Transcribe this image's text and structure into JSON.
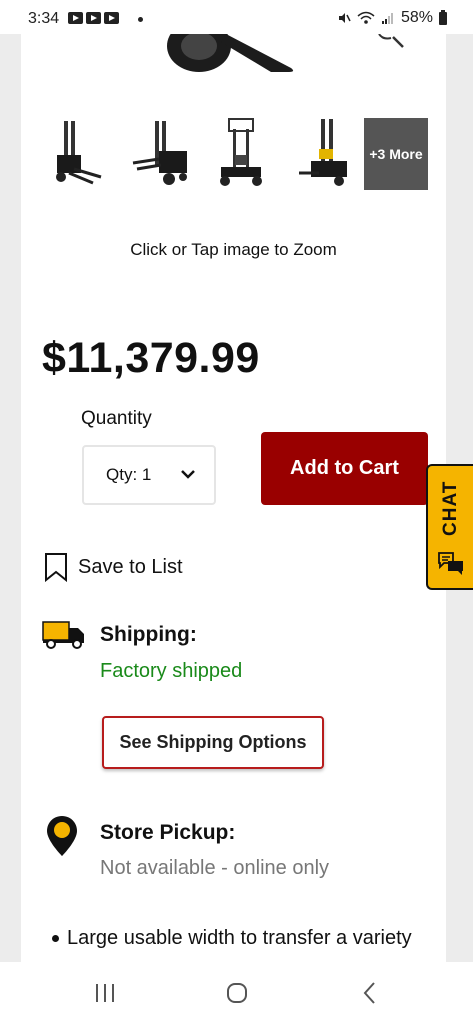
{
  "status_bar": {
    "time": "3:34",
    "battery": "58%"
  },
  "gallery": {
    "thumbnails": [
      {
        "icon": "forklift-thumbnail"
      },
      {
        "icon": "forklift-thumbnail"
      },
      {
        "icon": "forklift-thumbnail"
      },
      {
        "icon": "forklift-thumbnail"
      }
    ],
    "more_label": "+3 More",
    "zoom_hint": "Click or Tap image to Zoom"
  },
  "product": {
    "price": "$11,379.99",
    "quantity_label": "Quantity",
    "quantity_value": "Qty: 1",
    "add_to_cart_label": "Add to Cart",
    "save_to_list_label": "Save to List"
  },
  "shipping": {
    "title": "Shipping:",
    "status": "Factory shipped",
    "button_label": "See Shipping Options"
  },
  "pickup": {
    "title": "Store Pickup:",
    "status": "Not available - online only"
  },
  "features": {
    "first_bullet": "Large usable width to transfer a variety"
  },
  "chat": {
    "label": "CHAT"
  },
  "colors": {
    "brand_red": "#990000",
    "chat_yellow": "#f5b400",
    "shipping_green": "#1a8a1a"
  }
}
